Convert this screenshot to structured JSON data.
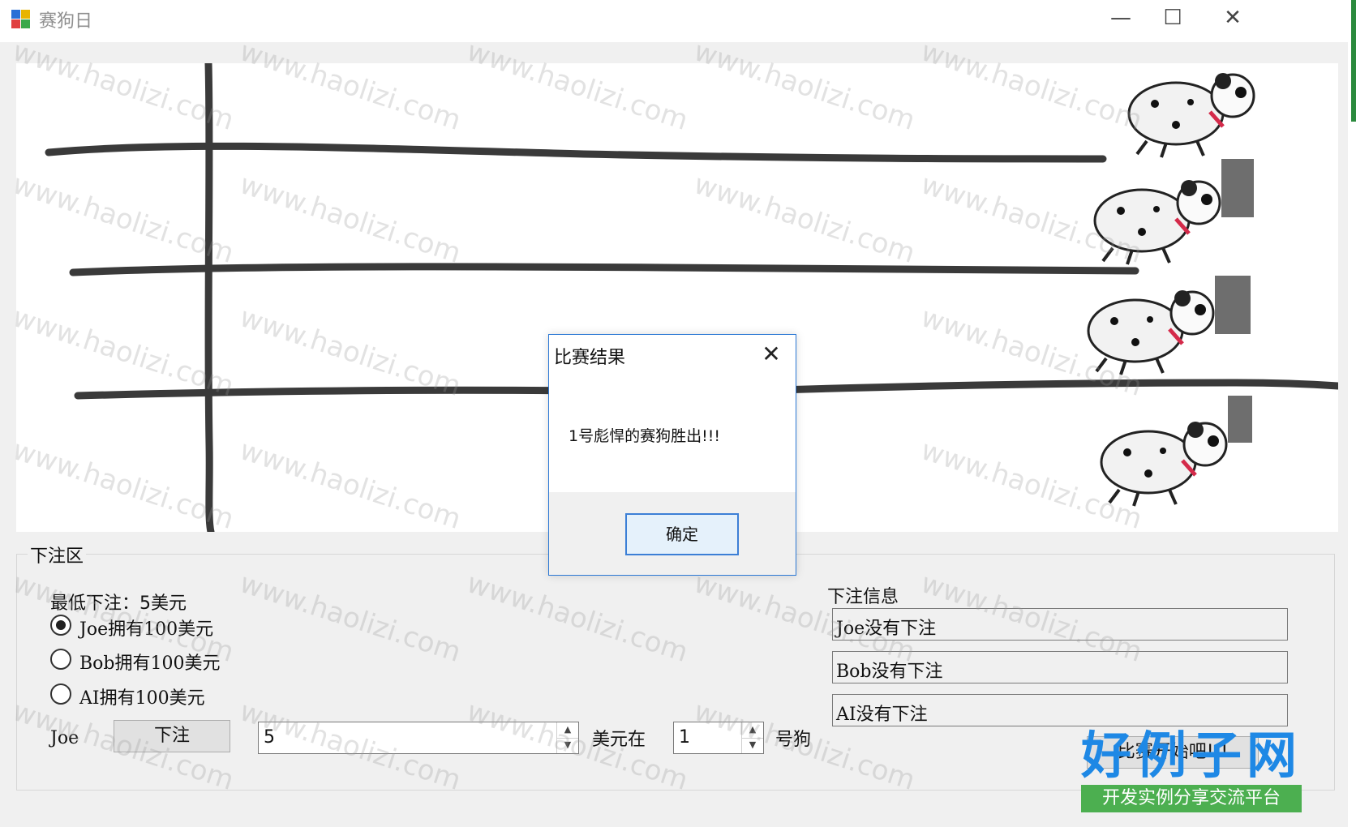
{
  "window": {
    "title": "赛狗日",
    "minimize": "—",
    "maximize": "☐",
    "close": "✕"
  },
  "bet_group": {
    "title": "下注区",
    "min_bet": "最低下注：5美元",
    "bettors": [
      {
        "label": "Joe拥有100美元",
        "selected": true
      },
      {
        "label": "Bob拥有100美元",
        "selected": false
      },
      {
        "label": "AI拥有100美元",
        "selected": false
      }
    ],
    "current_name": "Joe",
    "bet_button": "下注",
    "amount": "5",
    "dollars_at": "美元在",
    "dog_number": "1",
    "dog_suffix": "号狗"
  },
  "info": {
    "title": "下注信息",
    "rows": [
      "Joe没有下注",
      "Bob没有下注",
      "AI没有下注"
    ],
    "start_button": "比赛开始吧!!!"
  },
  "dialog": {
    "title": "比赛结果",
    "close": "✕",
    "message": "1号彪悍的赛狗胜出!!!",
    "ok": "确定"
  },
  "watermark": "www.haolizi.com",
  "logo": {
    "big": "好例子网",
    "sub": "开发实例分享交流平台"
  },
  "icons": [
    "app-icon",
    "minimize-icon",
    "maximize-icon",
    "close-icon",
    "dog-icon",
    "spin-up-icon",
    "spin-down-icon"
  ]
}
